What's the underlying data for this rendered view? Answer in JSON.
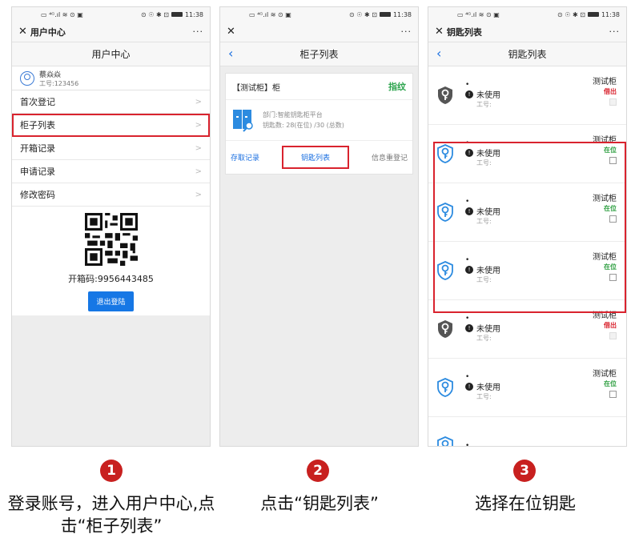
{
  "status": {
    "left": "▭ ⁴ᴳ.ıl ≋ ⊙ ▣",
    "right": "⊙ ☉ ✱ ⊡",
    "time": "11:38"
  },
  "panel1": {
    "title": "用户中心",
    "more": "···",
    "nav_title": "用户中心",
    "user": {
      "name": "蔡焱焱",
      "id": "工号:123456"
    },
    "menu": [
      {
        "label": "首次登记"
      },
      {
        "label": "柜子列表"
      },
      {
        "label": "开箱记录"
      },
      {
        "label": "申请记录"
      },
      {
        "label": "修改密码"
      }
    ],
    "code": "开箱码:9956443485",
    "logout": "退出登陆"
  },
  "panel2": {
    "title": "",
    "more": "···",
    "nav_title": "柜子列表",
    "cabinet": {
      "name": "【测试柜】柜",
      "badge": "指纹",
      "dept": "部门:智能钥匙柜平台",
      "keys": "钥匙数: 28(在位) /30 (总数)"
    },
    "actions": [
      "存取记录",
      "钥匙列表",
      "信息重登记"
    ]
  },
  "panel3": {
    "title": "钥匙列表",
    "more": "···",
    "nav_title": "钥匙列表",
    "items": [
      {
        "dot": "•",
        "status": "未使用",
        "work": "工号:",
        "cabinet": "测试柜",
        "state": "借出",
        "type": "out"
      },
      {
        "dot": "•",
        "status": "未使用",
        "work": "工号:",
        "cabinet": "测试柜",
        "state": "在位",
        "type": "in"
      },
      {
        "dot": "•",
        "status": "未使用",
        "work": "工号:",
        "cabinet": "测试柜",
        "state": "在位",
        "type": "in"
      },
      {
        "dot": "•",
        "status": "未使用",
        "work": "工号:",
        "cabinet": "测试柜",
        "state": "在位",
        "type": "in"
      },
      {
        "dot": "•",
        "status": "未使用",
        "work": "工号:",
        "cabinet": "测试柜",
        "state": "借出",
        "type": "out"
      },
      {
        "dot": "•",
        "status": "未使用",
        "work": "工号:",
        "cabinet": "测试柜",
        "state": "在位",
        "type": "in"
      },
      {
        "dot": "•",
        "status": "",
        "work": "",
        "cabinet": "",
        "state": "",
        "type": "in"
      }
    ]
  },
  "steps": [
    {
      "num": "1",
      "text": "登录账号，进入用户中心,点击“柜子列表”"
    },
    {
      "num": "2",
      "text": "点击“钥匙列表”"
    },
    {
      "num": "3",
      "text": "选择在位钥匙"
    }
  ],
  "colors": {
    "accent": "#1677e5",
    "highlight": "#d9232e",
    "in_place": "#2a9d3d",
    "lent": "#d9232e",
    "step": "#c8201f"
  }
}
